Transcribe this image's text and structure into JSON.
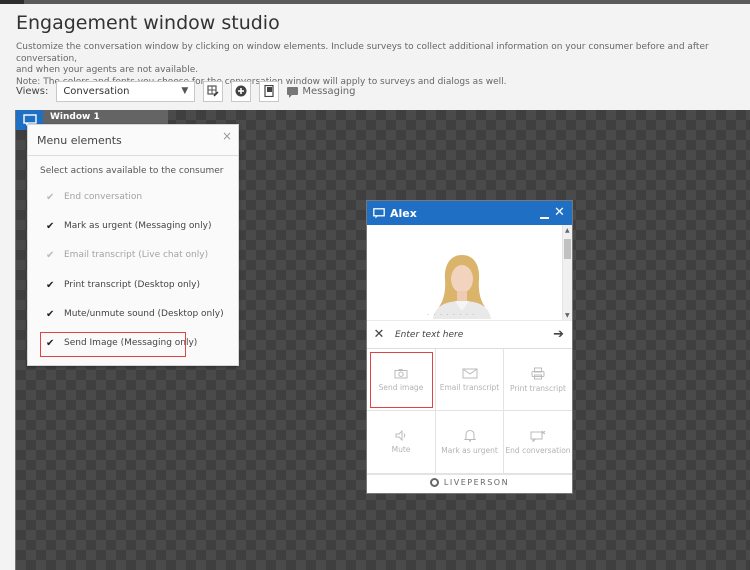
{
  "header": {
    "title": "Engagement window studio",
    "description_line1": "Customize the conversation window by clicking on window elements. Include surveys to collect additional information on your consumer before and after conversation,",
    "description_line2": "and when your agents are not available.",
    "description_line3": "Note: The colors and fonts you choose for the conversation window will apply to surveys and dialogs as well."
  },
  "toolbar": {
    "views_label": "Views:",
    "views_selected": "Conversation",
    "messaging_label": "Messaging"
  },
  "window_tab": {
    "label": "Window 1"
  },
  "menu_panel": {
    "title": "Menu elements",
    "close": "×",
    "subtitle": "Select actions available to the consumer",
    "options": [
      {
        "label": "End conversation",
        "checked": true,
        "disabled": true
      },
      {
        "label": "Mark as urgent (Messaging only)",
        "checked": true,
        "disabled": false
      },
      {
        "label": "Email transcript (Live chat only)",
        "checked": true,
        "disabled": true
      },
      {
        "label": "Print transcript (Desktop only)",
        "checked": true,
        "disabled": false
      },
      {
        "label": "Mute/unmute sound (Desktop only)",
        "checked": true,
        "disabled": false
      },
      {
        "label": "Send Image (Messaging only)",
        "checked": true,
        "disabled": false
      }
    ]
  },
  "chat_window": {
    "agent_name": "Alex",
    "input_placeholder": "Enter text here",
    "actions": [
      {
        "label": "Send image",
        "icon": "camera-icon"
      },
      {
        "label": "Email transcript",
        "icon": "envelope-icon"
      },
      {
        "label": "Print transcript",
        "icon": "printer-icon"
      },
      {
        "label": "Mute",
        "icon": "speaker-icon"
      },
      {
        "label": "Mark as urgent",
        "icon": "bell-icon"
      },
      {
        "label": "End conversation",
        "icon": "end-chat-icon"
      }
    ],
    "footer_brand": "LIVEPERSON"
  },
  "colors": {
    "accent": "#1f6fc4",
    "highlight": "#e04343"
  }
}
